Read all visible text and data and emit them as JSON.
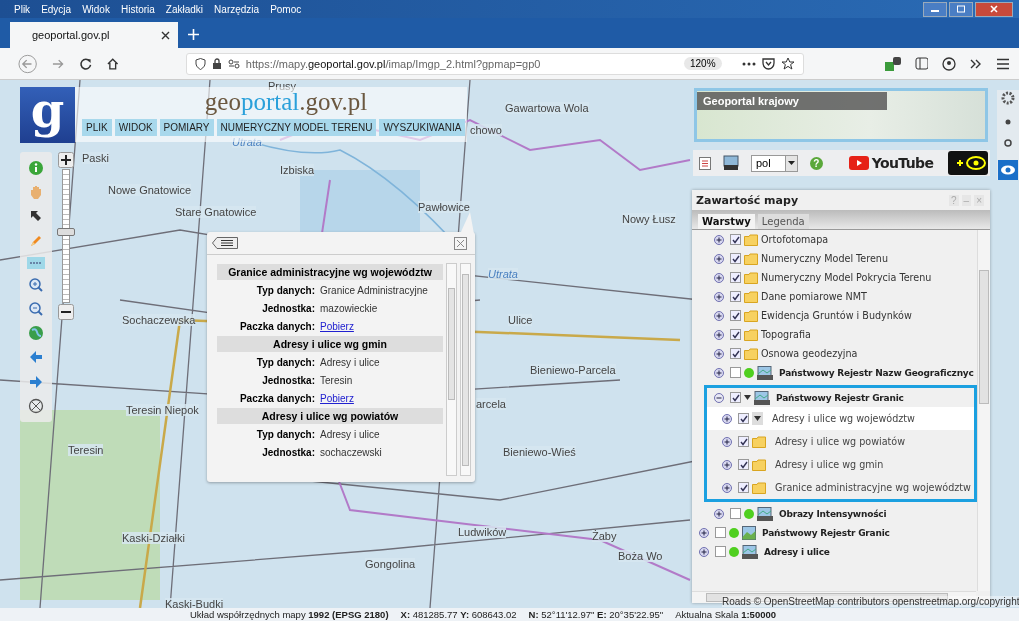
{
  "browser": {
    "menu": [
      "Plik",
      "Edycja",
      "Widok",
      "Historia",
      "Zakładki",
      "Narzędzia",
      "Pomoc"
    ],
    "tab": {
      "title": "geoportal.gov.pl"
    },
    "url": {
      "prefix": "https://mapy.",
      "domain": "geoportal.gov.pl",
      "path": "/imap/Imgp_2.html?gpmap=gp0"
    },
    "zoom": "120%"
  },
  "map_labels": [
    {
      "text": "Prusy",
      "kind": "place"
    },
    {
      "text": "Gawartowa Wola",
      "kind": "place"
    },
    {
      "text": "chowo",
      "kind": "place"
    },
    {
      "text": "Utrata",
      "kind": "river"
    },
    {
      "text": "Paski",
      "kind": "place"
    },
    {
      "text": "Izbiska",
      "kind": "place"
    },
    {
      "text": "Nowe Gnatowice",
      "kind": "place"
    },
    {
      "text": "Stare Gnatowice",
      "kind": "place"
    },
    {
      "text": "Pawłowice",
      "kind": "place"
    },
    {
      "text": "Nowy Łusz",
      "kind": "place"
    },
    {
      "text": "Utrata",
      "kind": "river"
    },
    {
      "text": "Sochaczewska",
      "kind": "place"
    },
    {
      "text": "Ulice",
      "kind": "place"
    },
    {
      "text": "Bieniewo-Parcela",
      "kind": "place"
    },
    {
      "text": "Teresin Niepok",
      "kind": "place"
    },
    {
      "text": "arcela",
      "kind": "place"
    },
    {
      "text": "Teresin",
      "kind": "place"
    },
    {
      "text": "Bieniewo-Wieś",
      "kind": "place"
    },
    {
      "text": "Kaski-Działki",
      "kind": "place"
    },
    {
      "text": "Ludwików",
      "kind": "place"
    },
    {
      "text": "Gongolina",
      "kind": "place"
    },
    {
      "text": "Żaby",
      "kind": "place"
    },
    {
      "text": "Boża Wo",
      "kind": "place"
    },
    {
      "text": "Kaski-Budki",
      "kind": "place"
    }
  ],
  "header": {
    "logo_letter": "g",
    "title_parts": [
      "geo",
      "portal",
      ".gov.pl"
    ],
    "menu": [
      "PLIK",
      "WIDOK",
      "POMIARY",
      "NUMERYCZNY MODEL TERENU",
      "WYSZUKIWANIA"
    ]
  },
  "zoom_slider": {
    "level": 0.53
  },
  "overview": {
    "title": "Geoportal krajowy"
  },
  "toolbar": {
    "language": "pol",
    "help": "?",
    "video": "YouTube"
  },
  "popup": {
    "sections": [
      {
        "title": "Granice administracyjne wg województw",
        "rows": [
          {
            "label": "Typ danych:",
            "value": "Granice Administracyjne",
            "kind": "text"
          },
          {
            "label": "Jednostka:",
            "value": "mazowieckie",
            "kind": "text"
          },
          {
            "label": "Paczka danych:",
            "value": "Pobierz",
            "kind": "link"
          }
        ]
      },
      {
        "title": "Adresy i ulice wg gmin",
        "rows": [
          {
            "label": "Typ danych:",
            "value": "Adresy i ulice",
            "kind": "text"
          },
          {
            "label": "Jednostka:",
            "value": "Teresin",
            "kind": "text"
          },
          {
            "label": "Paczka danych:",
            "value": "Pobierz",
            "kind": "link"
          }
        ]
      },
      {
        "title": "Adresy i ulice wg powiatów",
        "rows": [
          {
            "label": "Typ danych:",
            "value": "Adresy i ulice",
            "kind": "text"
          },
          {
            "label": "Jednostka:",
            "value": "sochaczewski",
            "kind": "text"
          }
        ]
      }
    ]
  },
  "layers_panel": {
    "title": "Zawartość mapy",
    "window_buttons": [
      "?",
      "–",
      "×"
    ],
    "tabs": [
      {
        "label": "Warstwy",
        "selected": true
      },
      {
        "label": "Legenda",
        "selected": false
      }
    ],
    "open_group_layers": [
      {
        "label": "Ortofotomapa",
        "kind": "folder",
        "checked": true,
        "expanded": false
      },
      {
        "label": "Numeryczny Model Terenu",
        "kind": "folder",
        "checked": true,
        "expanded": false
      },
      {
        "label": "Numeryczny Model Pokrycia Terenu",
        "kind": "folder",
        "checked": true,
        "expanded": false
      },
      {
        "label": "Dane pomiarowe NMT",
        "kind": "folder",
        "checked": true,
        "expanded": false
      },
      {
        "label": "Ewidencja Gruntów i Budynków",
        "kind": "folder",
        "checked": true,
        "expanded": false
      },
      {
        "label": "Topografia",
        "kind": "folder",
        "checked": true,
        "expanded": false
      },
      {
        "label": "Osnowa geodezyjna",
        "kind": "folder",
        "checked": true,
        "expanded": false
      },
      {
        "label": "Państwowy Rejestr Nazw Geograficznyc",
        "kind": "service",
        "checked": false,
        "expanded": false,
        "color": "#4fcf1f"
      },
      {
        "label": "Państwowy Rejestr Granic",
        "kind": "service",
        "checked": true,
        "expanded": true,
        "highlighted": true,
        "children": [
          {
            "label": "Adresy i ulice wg województw",
            "kind": "dropdown",
            "checked": true,
            "selected": true
          },
          {
            "label": "Adresy i ulice wg powiatów",
            "kind": "folder",
            "checked": true,
            "selected": false
          },
          {
            "label": "Adresy i ulice wg gmin",
            "kind": "folder",
            "checked": true,
            "selected": false
          },
          {
            "label": "Granice administracyjne wg województw",
            "kind": "folder",
            "checked": true,
            "selected": false
          }
        ]
      },
      {
        "label": "Obrazy Intensywności",
        "kind": "service",
        "checked": false,
        "expanded": false,
        "color": "#4fcf1f"
      }
    ],
    "layers": [
      {
        "label": "Państwowy Rejestr Granic",
        "kind": "image",
        "checked": false,
        "color": "#4fcf1f"
      },
      {
        "label": "Adresy i ulice",
        "kind": "service",
        "checked": false,
        "color": "#4fcf1f"
      }
    ]
  },
  "attribution": "Roads © OpenStreetMap contributors openstreetmap.org/copyright",
  "status_bar": [
    "Układ współrzędnych mapy **1992 (EPSG 2180)**",
    "**X:** 481285.77 **Y:** 608643.02",
    "**N:** 52°11'12.97\" **E:** 20°35'22.95\"",
    "Aktualna Skala **1:50000**"
  ]
}
